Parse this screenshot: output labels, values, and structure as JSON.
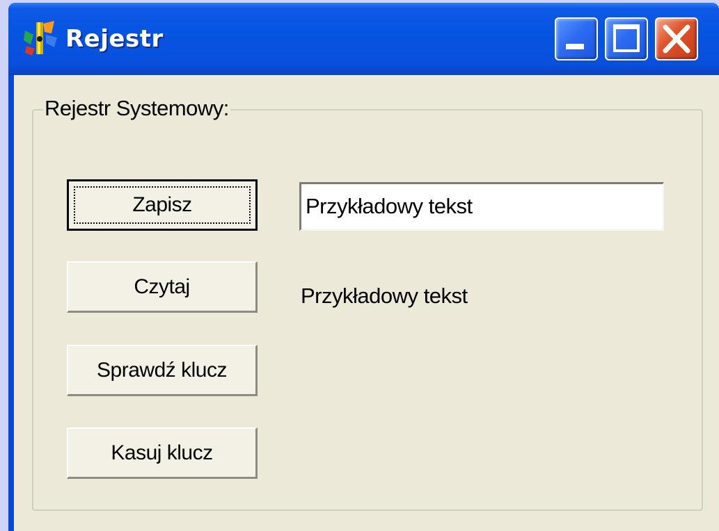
{
  "window": {
    "title": "Rejestr",
    "app_icon": "registry-app-icon",
    "controls": {
      "minimize_icon": "minimize-icon",
      "maximize_icon": "maximize-icon",
      "close_icon": "close-icon"
    }
  },
  "groupbox": {
    "label": "Rejestr Systemowy:"
  },
  "buttons": {
    "write": "Zapisz",
    "read": "Czytaj",
    "check_key": "Sprawdź klucz",
    "delete_key": "Kasuj klucz"
  },
  "input": {
    "value": "Przykładowy tekst"
  },
  "output_label": "Przykładowy tekst",
  "colors": {
    "titlebar": "#0654e2",
    "close_button": "#e0552e",
    "client_background": "#ece9d8"
  }
}
